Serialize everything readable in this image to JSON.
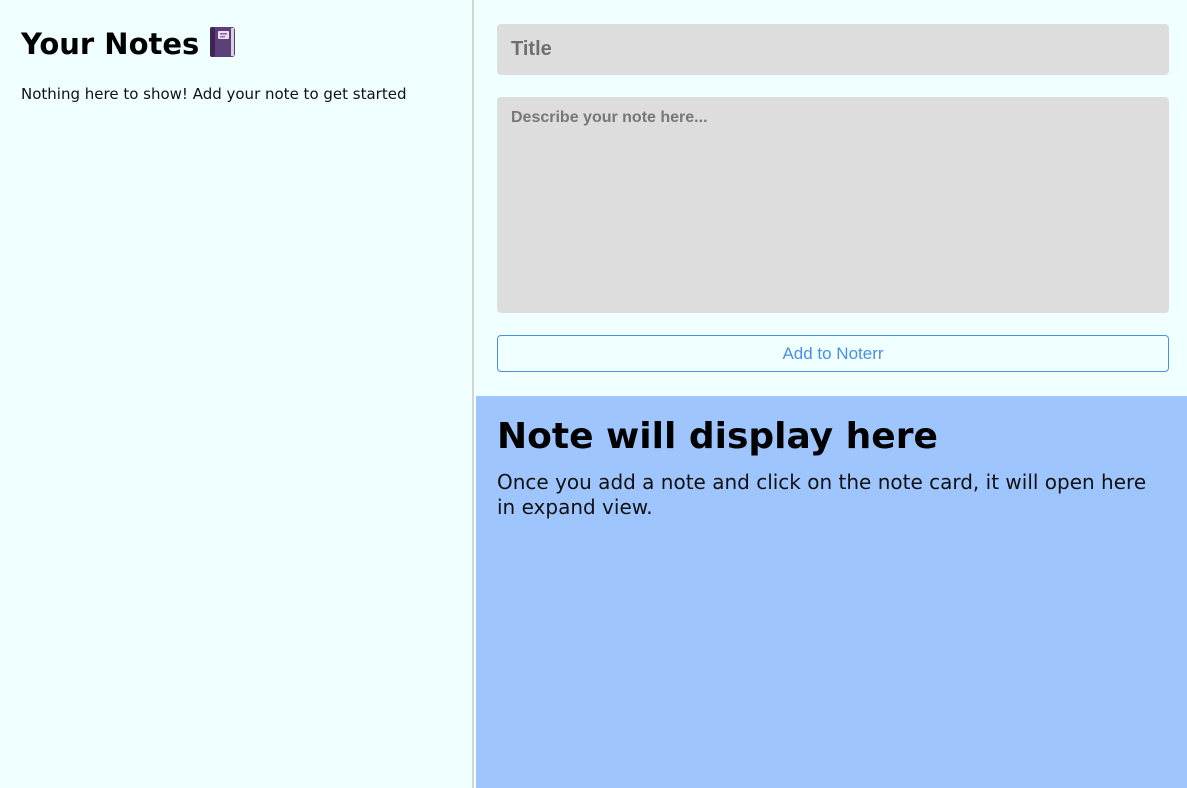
{
  "sidebar": {
    "title": "Your Notes",
    "title_icon": "notebook-icon",
    "empty_message": "Nothing here to show! Add your note to get started"
  },
  "form": {
    "title_placeholder": "Title",
    "description_placeholder": "Describe your note here...",
    "add_button_label": "Add to Noterr"
  },
  "display": {
    "heading": "Note will display here",
    "message": "Once you add a note and click on the note card, it will open here in expand view."
  },
  "colors": {
    "background": "#f0ffff",
    "input_background": "#dddddd",
    "accent": "#4a90e2",
    "display_background": "#9ec5fe"
  }
}
